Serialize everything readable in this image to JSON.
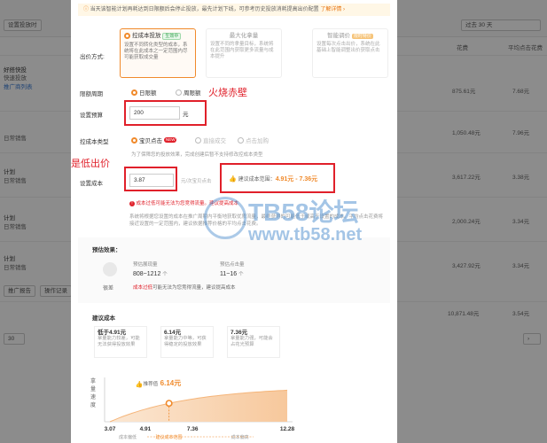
{
  "background": {
    "toolbar_left": "设置投放时",
    "toolbar_right": "过去 30 天",
    "col_cost": "花费",
    "col_avg": "平均点击花费",
    "rows": [
      {
        "name": "好搭快投",
        "sub": "快速投放",
        "extra": "推广商列表",
        "cost": "875.61元",
        "avg": "7.68元"
      },
      {
        "name": "日常销售",
        "sub": "",
        "extra": "",
        "cost": "1,050.48元",
        "avg": "7.96元"
      },
      {
        "name": "计划",
        "sub": "日常销售",
        "extra": "",
        "cost": "3,617.22元",
        "avg": "3.38元"
      },
      {
        "name": "计划",
        "sub": "日常销售",
        "extra": "",
        "cost": "2,000.24元",
        "avg": "3.34元"
      },
      {
        "name": "计划",
        "sub": "日常销售",
        "extra": "",
        "cost": "3,427.92元",
        "avg": "3.34元"
      },
      {
        "name": "",
        "sub": "",
        "extra": "",
        "cost": "10,871.48元",
        "avg": "3.54元"
      }
    ],
    "bottom_btn_1": "推广报告",
    "bottom_btn_2": "操作记录",
    "page_size": "30"
  },
  "notice": {
    "text": "当天该智能计划再耗达到日限额后会停止投放，最先计划下线，可参考历史投放消耗提高出价配置",
    "link": "了解详情 ›"
  },
  "bid_method": {
    "label": "出价方式:",
    "cards": [
      {
        "title": "控成本投放",
        "tag": "生效中",
        "desc": "设置不同转化类型的成本，系统将在此成本之一定范围内尽可能获取成交量"
      },
      {
        "title": "最大化拿量",
        "tag": "",
        "desc": "设置不同的拿量目标，系统将在此范围内获取更多流量与成本提升"
      },
      {
        "title": "智能调价",
        "tag": "限时特价",
        "desc": "设置每次点击出价，系统在此基础上智能调整出价获取点击"
      }
    ]
  },
  "budget_period": {
    "label": "限额周期",
    "opt1": "日限额",
    "opt2": "周限额"
  },
  "annotation_budget": "火烧赤壁",
  "budget": {
    "label": "设置预算",
    "value": "200",
    "unit": "元"
  },
  "cost_type": {
    "label": "控成本类型",
    "opt1": "宝贝点击",
    "new": "NEW",
    "opt2": "直接成交",
    "opt3": "点击加购",
    "hint": "为了保障您的投放效果，完成创建后暂不支持修改控成本类型"
  },
  "annotation_cost": "这个是低出价",
  "cost": {
    "label": "设置成本",
    "value": "3.87",
    "unit": "元/次宝贝点击"
  },
  "suggest": {
    "label": "建议成本范围：",
    "value": "4.91元 - 7.36元"
  },
  "cost_error": "成本过低可能无法为您竞得流量。建议提高成本",
  "cost_note": "系统将根据您设置的成本在推广周期内平衡地获取优质流量，最终获得的可能低于或高于设置的成本。平均点击花费将接近设置的一定范围内，建议依据推荐价格的平均点击花费。",
  "forecast": {
    "title": "预估效果：",
    "level": "很差",
    "k1": "预估展现量",
    "v1": "808~1212",
    "u1": "个",
    "k2": "预估点击量",
    "v2": "11~16",
    "u2": "个",
    "warn_red": "成本过低",
    "warn_rest": "可能无法为您竞得流量，建议提高成本"
  },
  "recommend": {
    "title": "建议成本",
    "cards": [
      {
        "value": "低于4.91元",
        "desc": "拿量能力较差，可能无法获得投放效果"
      },
      {
        "value": "6.14元",
        "desc": "拿量能力中等，可获得稳定的投放效果"
      },
      {
        "value": "7.36元",
        "desc": "拿量能力强，可能会占花光预算"
      }
    ]
  },
  "chart_data": {
    "type": "area",
    "ylabel": "拿量速度",
    "x_ticks": [
      "3.07",
      "4.91",
      "7.36",
      "12.28"
    ],
    "x_labels": [
      "成本偏低",
      "建议成本范围",
      "成本偏高"
    ],
    "marker_label": "推荐值",
    "marker_value": "6.14元"
  },
  "colors": {
    "accent": "#f08a2b",
    "alert": "#e0202a",
    "success": "#2e9e46"
  }
}
